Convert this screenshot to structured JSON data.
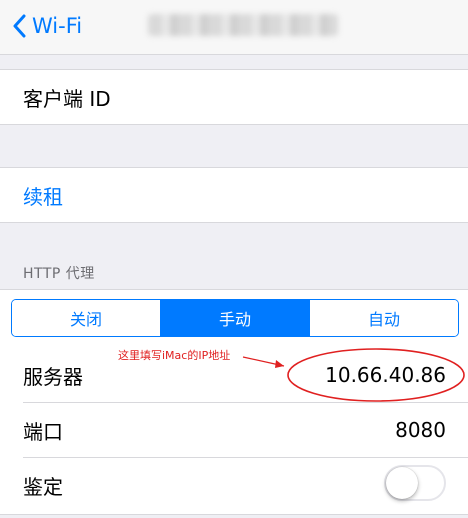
{
  "nav": {
    "back_label": "Wi-Fi",
    "back_icon": "chevron-left-icon",
    "title": ""
  },
  "dhcp": {
    "client_id_label": "客户端 ID",
    "client_id_value": ""
  },
  "renew": {
    "label": "续租"
  },
  "http_proxy": {
    "header": "HTTP 代理",
    "segments": [
      "关闭",
      "手动",
      "自动"
    ],
    "selected_segment": "手动",
    "server_label": "服务器",
    "server_value": "10.66.40.86",
    "port_label": "端口",
    "port_value": "8080",
    "auth_label": "鉴定",
    "auth_enabled": false
  },
  "annotation": {
    "text": "这里填写iMac的IP地址",
    "color": "#e02020"
  },
  "colors": {
    "accent": "#007aff",
    "background": "#efeff4",
    "annotation": "#e02020"
  }
}
